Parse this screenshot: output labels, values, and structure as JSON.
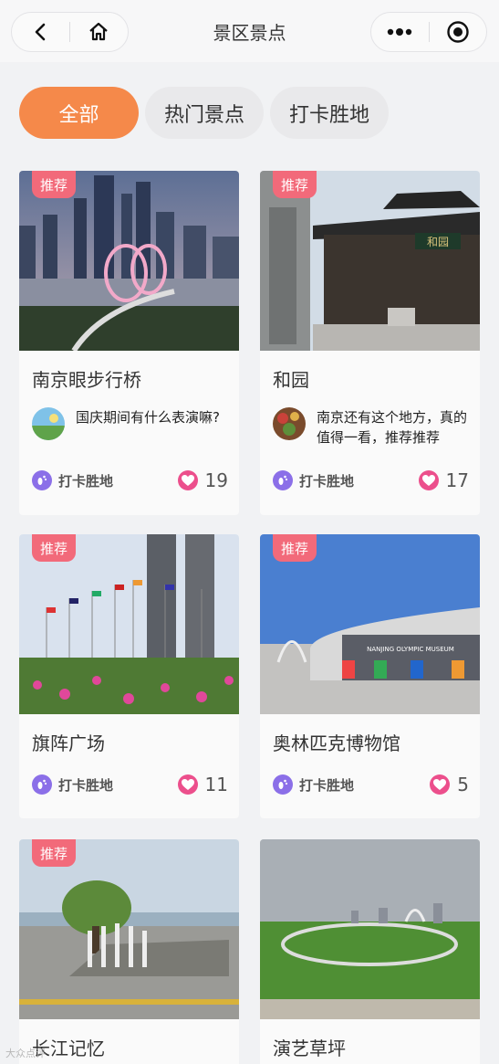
{
  "header": {
    "title": "景区景点"
  },
  "tabs": [
    {
      "label": "全部",
      "active": true
    },
    {
      "label": "热门景点",
      "active": false
    },
    {
      "label": "打卡胜地",
      "active": false
    }
  ],
  "cards": [
    {
      "badge": "推荐",
      "title": "南京眼步行桥",
      "comment": "国庆期间有什么表演嘛?",
      "tag": "打卡胜地",
      "likes": "19"
    },
    {
      "badge": "推荐",
      "title": "和园",
      "comment": "南京还有这个地方，真的值得一看，推荐推荐",
      "tag": "打卡胜地",
      "likes": "17"
    },
    {
      "badge": "推荐",
      "title": "旗阵广场",
      "tag": "打卡胜地",
      "likes": "11"
    },
    {
      "badge": "推荐",
      "title": "奥林匹克博物馆",
      "tag": "打卡胜地",
      "likes": "5"
    },
    {
      "badge": "推荐",
      "title": "长江记忆"
    },
    {
      "title": "演艺草坪"
    }
  ],
  "images": {
    "card5_sign": "和园",
    "card4_sign": "NANJING OLYMPIC MUSEUM"
  },
  "watermark": "大众点评",
  "colors": {
    "accent": "#f5894a",
    "badge": "#f26a7a",
    "tag": "#8b6fe8",
    "heart": "#ec4f8c"
  },
  "icons": [
    "back-icon",
    "home-icon",
    "more-icon",
    "capture-icon",
    "footprint-icon",
    "heart-icon"
  ]
}
